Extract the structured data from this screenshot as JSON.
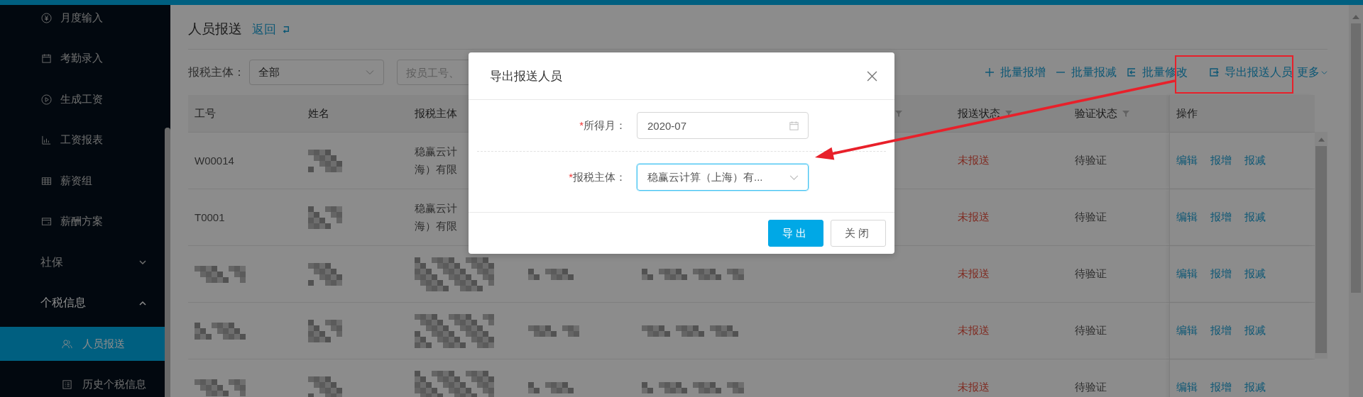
{
  "sidebar": {
    "items": [
      {
        "kind": "item",
        "label": "月度输入"
      },
      {
        "kind": "item",
        "label": "考勤录入"
      },
      {
        "kind": "item",
        "label": "生成工资"
      },
      {
        "kind": "item",
        "label": "工资报表"
      },
      {
        "kind": "item",
        "label": "薪资组"
      },
      {
        "kind": "item",
        "label": "薪酬方案"
      },
      {
        "kind": "group",
        "label": "社保",
        "expanded": false
      },
      {
        "kind": "group",
        "label": "个税信息",
        "expanded": true,
        "children": [
          {
            "label": "人员报送",
            "selected": true
          },
          {
            "label": "历史个税信息",
            "selected": false
          }
        ]
      }
    ]
  },
  "page": {
    "title": "人员报送",
    "back_link": "返回"
  },
  "filters": {
    "entity_label": "报税主体：",
    "entity_value": "全部",
    "search_placeholder": "按员工号、"
  },
  "toolbar": [
    {
      "kind": "add",
      "label": "批量报增",
      "highlighted": false
    },
    {
      "kind": "remove",
      "label": "批量报减",
      "highlighted": false
    },
    {
      "kind": "edit",
      "label": "批量修改",
      "highlighted": false
    },
    {
      "kind": "export",
      "label": "导出报送人员",
      "highlighted": true
    },
    {
      "kind": "more",
      "label": "更多",
      "highlighted": false
    }
  ],
  "table": {
    "columns": [
      {
        "label": "工号",
        "filterable": false
      },
      {
        "label": "姓名",
        "filterable": false
      },
      {
        "label": "报税主体",
        "filterable": false
      },
      {
        "filterable": true
      },
      {
        "label": "报送状态",
        "filterable": true
      },
      {
        "label": "验证状态",
        "filterable": true
      },
      {
        "label": "操作",
        "filterable": false
      }
    ],
    "rows": [
      {
        "redacted": false,
        "id": "W00014",
        "entity": [
          "稳赢云计",
          "海）有限"
        ],
        "status": {
          "kind": "unsent",
          "label": "未报送"
        },
        "verification": "待验证",
        "actions": [
          "编辑",
          "报增",
          "报减"
        ]
      },
      {
        "redacted": false,
        "id": "T0001",
        "entity": [
          "稳赢云计",
          "海）有限"
        ],
        "status": {
          "kind": "unsent",
          "label": "未报送"
        },
        "verification": "待验证",
        "actions": [
          "编辑",
          "报增",
          "报减"
        ]
      },
      {
        "redacted": true,
        "status": {
          "kind": "unsent",
          "label": "未报送"
        },
        "verification": "待验证",
        "actions": [
          "编辑",
          "报增",
          "报减"
        ]
      },
      {
        "redacted": true,
        "status": {
          "kind": "unsent",
          "label": "未报送"
        },
        "verification": "待验证",
        "actions": [
          "编辑",
          "报增",
          "报减"
        ]
      },
      {
        "redacted": true,
        "status": {
          "kind": "unsent",
          "label": "未报送"
        },
        "verification": "待验证",
        "actions": [
          "编辑",
          "报增",
          "报减"
        ]
      }
    ]
  },
  "dialog": {
    "title": "导出报送人员",
    "fields": [
      {
        "kind": "date",
        "required_mark": "*",
        "label": "所得月：",
        "value": "2020-07",
        "focused": false
      },
      {
        "kind": "select",
        "required_mark": "*",
        "label": "报税主体：",
        "value": "稳赢云计算（上海）有...",
        "focused": true
      }
    ],
    "buttons": [
      {
        "kind": "primary",
        "label": "导出"
      },
      {
        "kind": "default",
        "label": "关闭"
      }
    ]
  },
  "annotation": {
    "kind": "arrow"
  }
}
